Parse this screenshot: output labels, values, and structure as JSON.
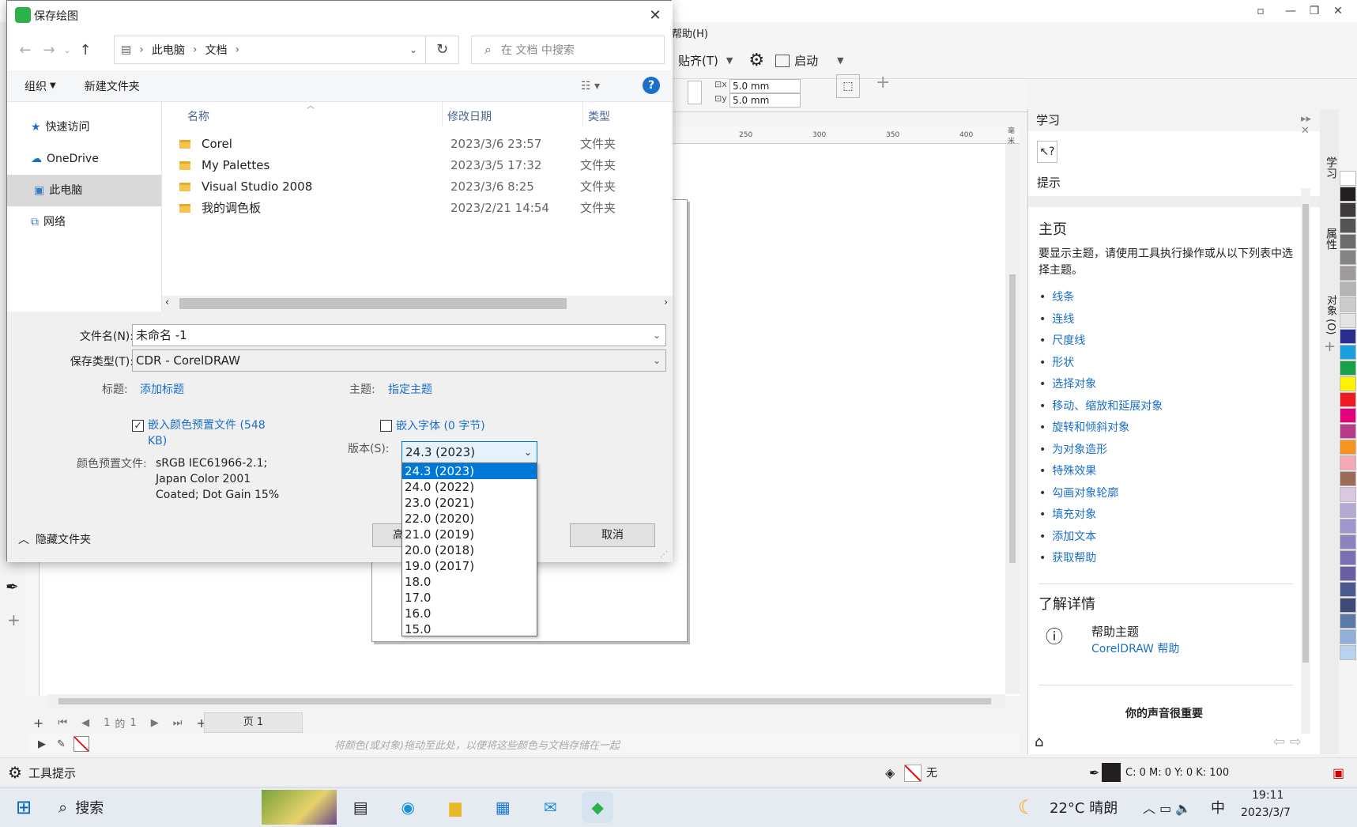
{
  "app": {
    "menu_help": "帮助(H)",
    "snap_label": "贴齐(T)",
    "launch_label": "启动",
    "nudge_x": "5.0 mm",
    "nudge_y": "5.0 mm",
    "ruler_ticks": [
      "250",
      "300",
      "350",
      "400",
      "毫米"
    ],
    "page_nav": {
      "current": "1",
      "of": "的",
      "total": "1",
      "page_tab": "页 1"
    },
    "color_docker_hint": "将颜色(或对象)拖动至此处，以便将这些颜色与文档存储在一起",
    "status": {
      "tool_hint": "工具提示",
      "fill_none": "无",
      "cmyk": "C:  0 M:  0 Y:  0 K:  100"
    }
  },
  "learn_panel": {
    "title": "学习",
    "hint_label": "提示",
    "home_heading": "主页",
    "intro": "要显示主题，请使用工具执行操作或从以下列表中选择主题。",
    "topics": [
      "线条",
      "连线",
      "尺度线",
      "形状",
      "选择对象",
      "移动、缩放和延展对象",
      "旋转和倾斜对象",
      "为对象造形",
      "特殊效果",
      "勾画对象轮廓",
      "填充对象",
      "添加文本",
      "获取帮助"
    ],
    "learn_more_heading": "了解详情",
    "help_topic_title": "帮助主题",
    "help_topic_link": "CorelDRAW 帮助",
    "feedback_heading": "你的声音很重要",
    "side_tabs": [
      "学习",
      "属性",
      "对象 (O)"
    ]
  },
  "palette_colors": [
    "#ffffff",
    "#231f20",
    "#3d3b3c",
    "#555354",
    "#6d6b6c",
    "#858384",
    "#9d9b9c",
    "#b5b3b4",
    "#cdcbcc",
    "#e5e3e4",
    "#2b2e8f",
    "#1aa0e0",
    "#18a04a",
    "#fff200",
    "#ed1c24",
    "#e6007e",
    "#b83a8b",
    "#f7941d",
    "#f5a8b8",
    "#9b6b5a",
    "#d9c8e0",
    "#b5a8d4",
    "#9f96cc",
    "#8d82c0",
    "#7b6fb3",
    "#6a5fa5",
    "#4b5a8f",
    "#3f4a78",
    "#5a7aa8",
    "#8fb0d8",
    "#b7d3ee"
  ],
  "dialog": {
    "title": "保存绘图",
    "breadcrumb": [
      "此电脑",
      "文档"
    ],
    "search_placeholder": "在 文档 中搜索",
    "organize": "组织",
    "new_folder": "新建文件夹",
    "nav_items": [
      "快速访问",
      "OneDrive",
      "此电脑",
      "网络"
    ],
    "columns": {
      "name": "名称",
      "modified": "修改日期",
      "type": "类型"
    },
    "files": [
      {
        "name": "Corel",
        "modified": "2023/3/6 23:57",
        "type": "文件夹"
      },
      {
        "name": "My Palettes",
        "modified": "2023/3/5 17:32",
        "type": "文件夹"
      },
      {
        "name": "Visual Studio 2008",
        "modified": "2023/3/6 8:25",
        "type": "文件夹"
      },
      {
        "name": "我的调色板",
        "modified": "2023/2/21 14:54",
        "type": "文件夹"
      }
    ],
    "filename_label": "文件名(N):",
    "filename_value": "未命名 -1",
    "filetype_label": "保存类型(T):",
    "filetype_value": "CDR - CorelDRAW",
    "title_label": "标题:",
    "title_link": "添加标题",
    "subject_label": "主题:",
    "subject_link": "指定主题",
    "embed_profile_label": "嵌入颜色预置文件 (548",
    "embed_profile_label2": "KB)",
    "embed_fonts_label": "嵌入字体 (0 字节)",
    "color_profile_label": "颜色预置文件:",
    "color_profile_lines": [
      "sRGB IEC61966-2.1;",
      "Japan Color 2001",
      "Coated; Dot Gain 15%"
    ],
    "version_label": "版本(S):",
    "version_value": "24.3 (2023)",
    "version_options": [
      "24.3 (2023)",
      "24.0 (2022)",
      "23.0 (2021)",
      "22.0 (2020)",
      "21.0 (2019)",
      "20.0 (2018)",
      "19.0 (2017)",
      "18.0",
      "17.0",
      "16.0",
      "15.0"
    ],
    "advanced_btn": "高级",
    "cancel_btn": "取消",
    "hide_folders": "隐藏文件夹"
  },
  "taskbar": {
    "search": "搜索",
    "weather": "22°C  晴朗",
    "ime": "中",
    "time": "19:11",
    "date": "2023/3/7"
  }
}
